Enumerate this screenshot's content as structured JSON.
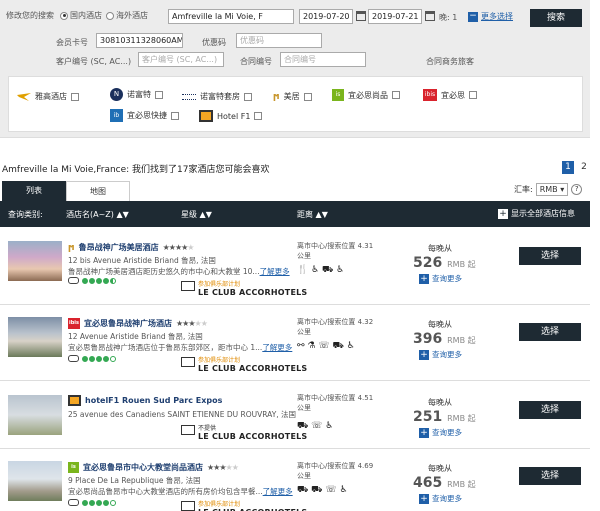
{
  "search": {
    "label_modify": "修改您的搜索",
    "radio_domestic": "国内酒店",
    "radio_overseas": "海外酒店",
    "destination": "Amfreville la Mi Voie, F",
    "checkin": "2019-07-20",
    "checkout": "2019-07-21",
    "nights_label": "晚: 1",
    "more_options": "更多选择",
    "search_button": "搜索",
    "member_card_label": "会员卡号",
    "member_card_value": "30810311328060AM",
    "promo_label": "优惠码",
    "promo_placeholder": "优惠码",
    "client_id_label": "客户编号 (SC, AC...)",
    "client_id_placeholder": "客户编号 (SC, AC...)",
    "contract_label": "合同编号",
    "contract_placeholder": "合同编号",
    "business_traveler": "合同商务旅客"
  },
  "brands": [
    {
      "name": "雅高酒店"
    },
    {
      "name": "诺富特"
    },
    {
      "name": "诺富特套房"
    },
    {
      "name": "美居"
    },
    {
      "name": "宜必思尚品"
    },
    {
      "name": "宜必思"
    },
    {
      "name": "宜必思快捷"
    },
    {
      "name": "Hotel F1"
    }
  ],
  "results": {
    "title": "Amfreville la Mi Voie,France: 我们找到了17家酒店您可能会喜欢",
    "pages": [
      "1",
      "2"
    ],
    "tab_list": "列表",
    "tab_map": "地图",
    "currency_label": "汇率:",
    "currency_value": "RMB",
    "help": "?",
    "col_sort": "查询类别:",
    "col_name": "酒店名(A~Z) ▲▼",
    "col_stars": "星级 ▲▼",
    "col_distance": "距离 ▲▼",
    "show_all": "显示全部酒店信息"
  },
  "hotels": [
    {
      "name": "鲁昂战神广场美居酒店",
      "stars": 4,
      "address": "12 bis Avenue Aristide Briand 鲁昂, 法国",
      "desc": "鲁昂战神广场美居酒店距历史悠久的市中心和大教堂 10...",
      "more_link": "了解更多",
      "rating": 4.5,
      "club_top": "参加俱乐部计划",
      "club_main": "LE CLUB ACCORHOTELS",
      "distance": "离市中心/搜索位置 4.31 公里",
      "amenities": "🍴 ♿ ⛟ ♿",
      "price_label": "每晚从",
      "price": "526",
      "price_unit": "RMB 起",
      "more_info": "查询更多",
      "select": "选择"
    },
    {
      "name": "宜必思鲁昂战神广场酒店",
      "stars": 3,
      "address": "12 Avenue Aristide Briand 鲁昂, 法国",
      "desc": "宜必思鲁昂战神广场酒店位于鲁昂东部郊区，距市中心 1...",
      "more_link": "了解更多",
      "rating": 4,
      "club_top": "参加俱乐部计划",
      "club_main": "LE CLUB ACCORHOTELS",
      "distance": "离市中心/搜索位置 4.32 公里",
      "amenities": "⚯ ⚗ ☏ ⛟ ♿",
      "price_label": "每晚从",
      "price": "396",
      "price_unit": "RMB 起",
      "more_info": "查询更多",
      "select": "选择"
    },
    {
      "name": "hotelF1 Rouen Sud Parc Expos",
      "stars": 0,
      "address": "25 avenue des Canadiens SAINT ETIENNE DU ROUVRAY, 法国",
      "desc": "",
      "more_link": "",
      "rating": 0,
      "club_top": "不提供",
      "club_main": "LE CLUB ACCORHOTELS",
      "distance": "离市中心/搜索位置 4.51 公里",
      "amenities": "⛟ ☏ ♿",
      "price_label": "每晚从",
      "price": "251",
      "price_unit": "RMB 起",
      "more_info": "查询更多",
      "select": "选择"
    },
    {
      "name": "宜必思鲁昂市中心大教堂尚品酒店",
      "stars": 3,
      "address": "9 Place De La Republique 鲁昂, 法国",
      "desc": "宜必思尚品鲁昂市中心大教堂酒店的所有房价均包含早餐...",
      "more_link": "了解更多",
      "rating": 4,
      "club_top": "参加俱乐部计划",
      "club_main": "LE CLUB ACCORHOTELS",
      "distance": "离市中心/搜索位置 4.69 公里",
      "amenities": "⛟ ⛟ ☏ ♿",
      "price_label": "每晚从",
      "price": "465",
      "price_unit": "RMB 起",
      "more_info": "查询更多",
      "select": "选择"
    }
  ],
  "colors": {
    "dark": "#1e2a33",
    "brand_blue": "#1f5fa8",
    "ibis_red": "#d9232d",
    "novotel_navy": "#1a2f5c",
    "ta_green": "#34a853",
    "club_orange": "#e08a00"
  }
}
